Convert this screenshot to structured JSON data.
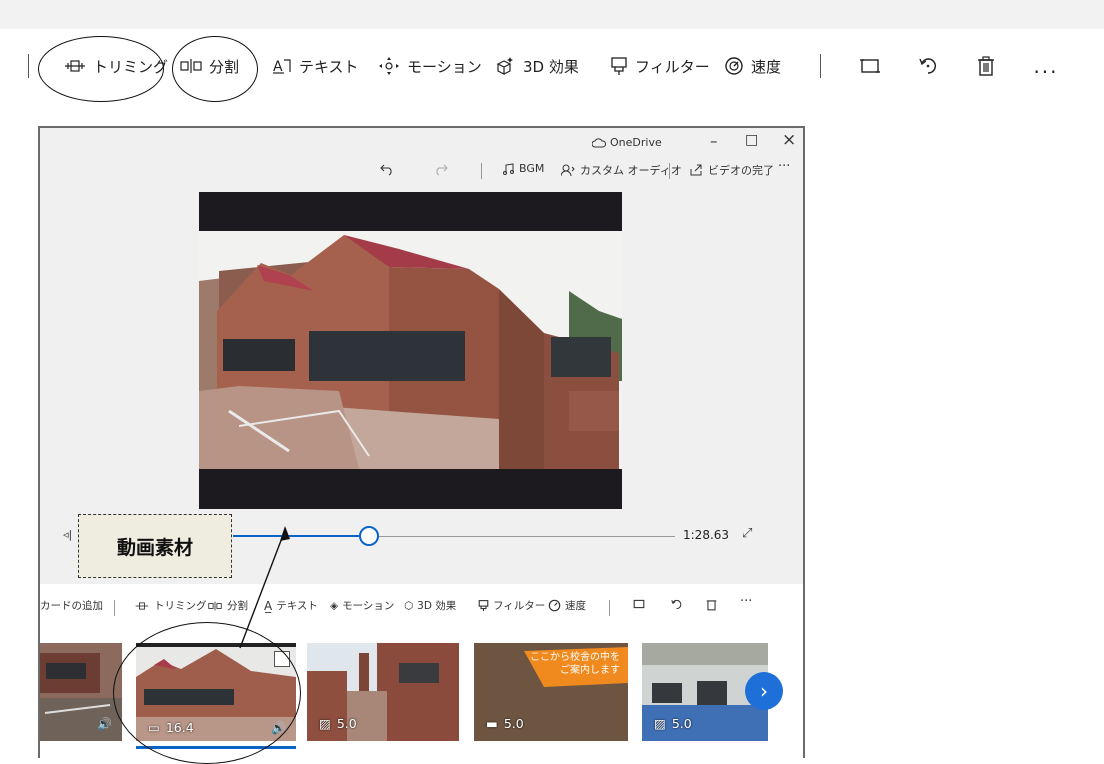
{
  "toolbar": {
    "trim": "トリミング",
    "split": "分割",
    "text": "テキスト",
    "motion": "モーション",
    "effects3d": "3D 効果",
    "filter": "フィルター",
    "speed": "速度",
    "more": "..."
  },
  "window": {
    "onedrive": "OneDrive",
    "minimize": "–",
    "maximize": "□",
    "close": "×",
    "bgm": "BGM",
    "custom_audio": "カスタム オーディオ",
    "finish_video": "ビデオの完了",
    "more": "···"
  },
  "timeline": {
    "duration": "1:28.63",
    "progress": 0.42
  },
  "story": {
    "add_card": "カードの追加",
    "trim": "トリミング",
    "split": "分割",
    "text": "テキスト",
    "motion": "モーション",
    "effects3d": "3D 効果",
    "filter": "フィルター",
    "speed": "速度",
    "more": "···",
    "clips": [
      {
        "label": ""
      },
      {
        "label": "16.4"
      },
      {
        "label": "5.0"
      },
      {
        "label": "5.0",
        "overlay_text_1": "ここから校舎の中を",
        "overlay_text_2": "ご案内します"
      },
      {
        "label": "5.0"
      }
    ]
  },
  "callout": {
    "text": "動画素材"
  },
  "colors": {
    "accent": "#0a64c8",
    "next_button": "#1e6fd8"
  }
}
